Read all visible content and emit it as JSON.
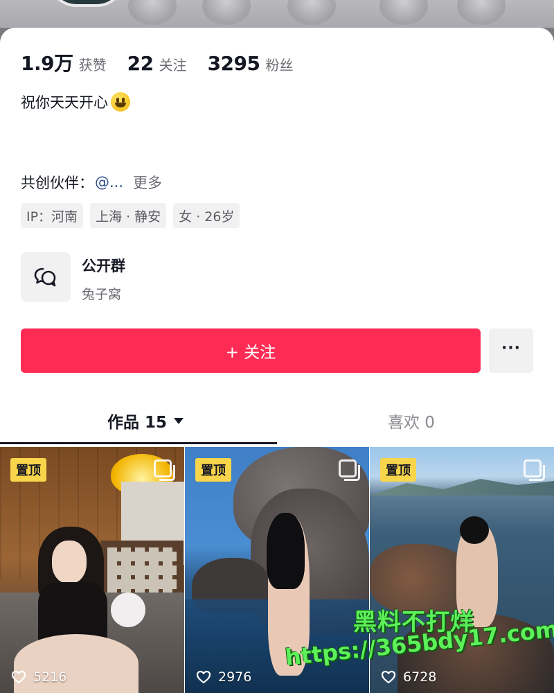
{
  "stats": [
    {
      "value": "1.9万",
      "label": "获赞"
    },
    {
      "value": "22",
      "label": "关注"
    },
    {
      "value": "3295",
      "label": "粉丝"
    }
  ],
  "bio": "祝你天天开心",
  "cocreate": {
    "label": "共创伙伴：",
    "handle": "@...",
    "more": "更多"
  },
  "tags": [
    "IP：河南",
    "上海 · 静安",
    "女 · 26岁"
  ],
  "group": {
    "title": "公开群",
    "subtitle": "兔子窝"
  },
  "actions": {
    "follow": "+ 关注",
    "more": "···"
  },
  "tabs": {
    "works": "作品 15",
    "likes": "喜欢 0"
  },
  "videos": [
    {
      "pinned": "置顶",
      "likes": "5216"
    },
    {
      "pinned": "置顶",
      "likes": "2976"
    },
    {
      "pinned": "置顶",
      "likes": "6728"
    }
  ],
  "watermark": {
    "line1": "黑料不打烊",
    "line2": "https://365bdy17.com"
  },
  "colors": {
    "accent": "#fe2c55",
    "pin": "#f8d54a",
    "watermark": "#5df05a"
  }
}
